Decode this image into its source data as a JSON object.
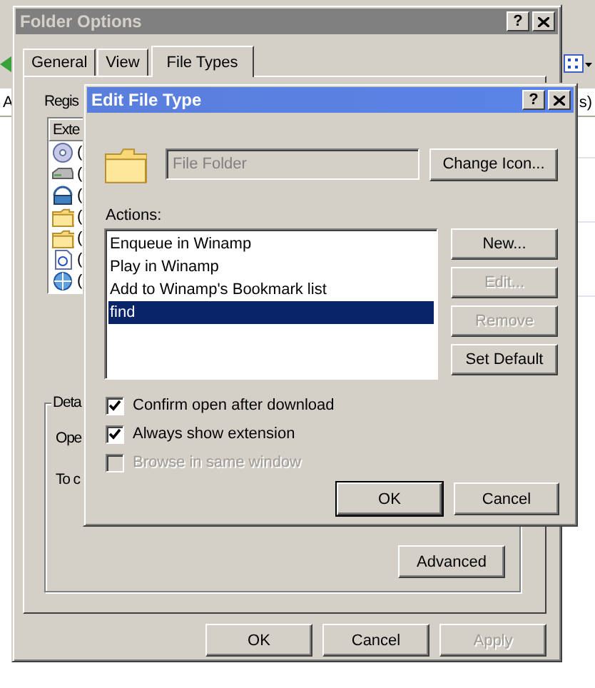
{
  "background_window": {
    "address_label": "A",
    "column_text": "s)"
  },
  "folder_options": {
    "title": "Folder Options",
    "active": false,
    "help_button": "?",
    "tabs": [
      {
        "label": "General",
        "selected": false
      },
      {
        "label": "View",
        "selected": false
      },
      {
        "label": "File Types",
        "selected": true
      }
    ],
    "registered_label": "Regis",
    "list_header": "Exte",
    "list_rows": [
      {
        "text": "("
      },
      {
        "text": "("
      },
      {
        "text": "("
      },
      {
        "text": "("
      },
      {
        "text": "("
      },
      {
        "text": "("
      },
      {
        "text": "("
      }
    ],
    "details_label": "Deta",
    "opens_label": "Ope",
    "to_label": "To c",
    "advanced_button": "Advanced",
    "buttons": [
      {
        "label": "OK",
        "disabled": false
      },
      {
        "label": "Cancel",
        "disabled": false
      },
      {
        "label": "Apply",
        "disabled": true
      }
    ]
  },
  "edit_file_type": {
    "title": "Edit File Type",
    "active": true,
    "help_button": "?",
    "file_type_field": {
      "value": "File Folder",
      "disabled": true
    },
    "change_icon_button": "Change Icon...",
    "actions_label": "Actions:",
    "actions": [
      {
        "label": "Enqueue in Winamp",
        "selected": false
      },
      {
        "label": "Play in Winamp",
        "selected": false
      },
      {
        "label": "Add to Winamp's Bookmark list",
        "selected": false
      },
      {
        "label": "find",
        "selected": true
      }
    ],
    "side_buttons": [
      {
        "label": "New...",
        "disabled": false
      },
      {
        "label": "Edit...",
        "disabled": true
      },
      {
        "label": "Remove",
        "disabled": true
      },
      {
        "label": "Set Default",
        "disabled": false
      }
    ],
    "checkboxes": [
      {
        "label": "Confirm open after download",
        "checked": true,
        "disabled": false
      },
      {
        "label": "Always show extension",
        "checked": true,
        "disabled": false
      },
      {
        "label": "Browse in same window",
        "checked": false,
        "disabled": true
      }
    ],
    "buttons": [
      {
        "label": "OK",
        "default": true
      },
      {
        "label": "Cancel",
        "default": false
      }
    ]
  }
}
